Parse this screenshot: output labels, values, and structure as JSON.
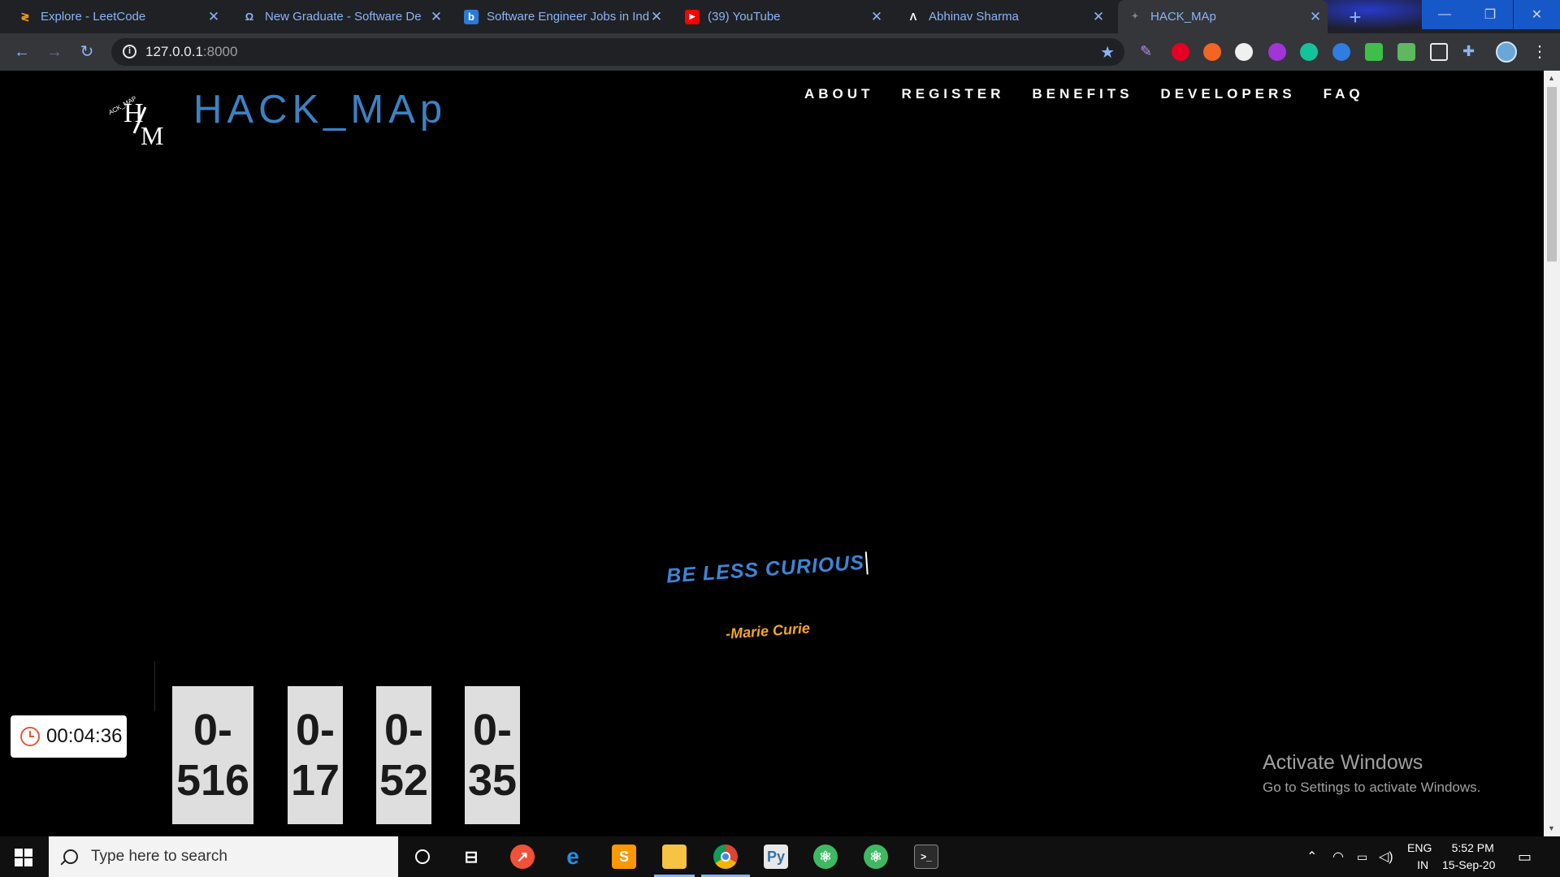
{
  "browser": {
    "tabs": [
      {
        "title": "Explore - LeetCode",
        "favicon": "leetcode-icon",
        "color": "#f89f1b"
      },
      {
        "title": "New Graduate - Software De",
        "favicon": "wiley-icon",
        "color": "#3b82c4"
      },
      {
        "title": "Software Engineer Jobs in Ind",
        "favicon": "bing-icon",
        "color": "#2b7ad8"
      },
      {
        "title": "(39) YouTube",
        "favicon": "youtube-icon",
        "color": "#ff0000"
      },
      {
        "title": "Abhinav Sharma",
        "favicon": "a-logo-icon",
        "color": "#ffffff"
      },
      {
        "title": "HACK_MAp",
        "favicon": "hackmap-icon",
        "color": "#888888"
      }
    ],
    "url_host": "127.0.0.1",
    "url_port": ":8000"
  },
  "site": {
    "logo_text": "HACK_MAp",
    "logo_ring_text": "ACK_MAP",
    "logo_letters": {
      "h": "H",
      "m": "M"
    },
    "nav": [
      "ABOUT",
      "REGISTER",
      "BENEFITS",
      "DEVELOPERS",
      "FAQ"
    ],
    "quote": "BE LESS CURIOUS",
    "author": "-Marie Curie",
    "countdown": [
      {
        "top": "0-",
        "bottom": "516"
      },
      {
        "top": "0-",
        "bottom": "17"
      },
      {
        "top": "0-",
        "bottom": "52"
      },
      {
        "top": "0-",
        "bottom": "35"
      }
    ],
    "colors": {
      "logo": "#3b82c4",
      "quote": "#3d85d6",
      "author": "#f5a623"
    }
  },
  "timer": {
    "value": "00:04:36"
  },
  "watermark": {
    "title": "Activate Windows",
    "subtitle": "Go to Settings to activate Windows."
  },
  "taskbar": {
    "search_placeholder": "Type here to search",
    "lang": "ENG",
    "region": "IN",
    "time": "5:52 PM",
    "date": "15-Sep-20"
  }
}
